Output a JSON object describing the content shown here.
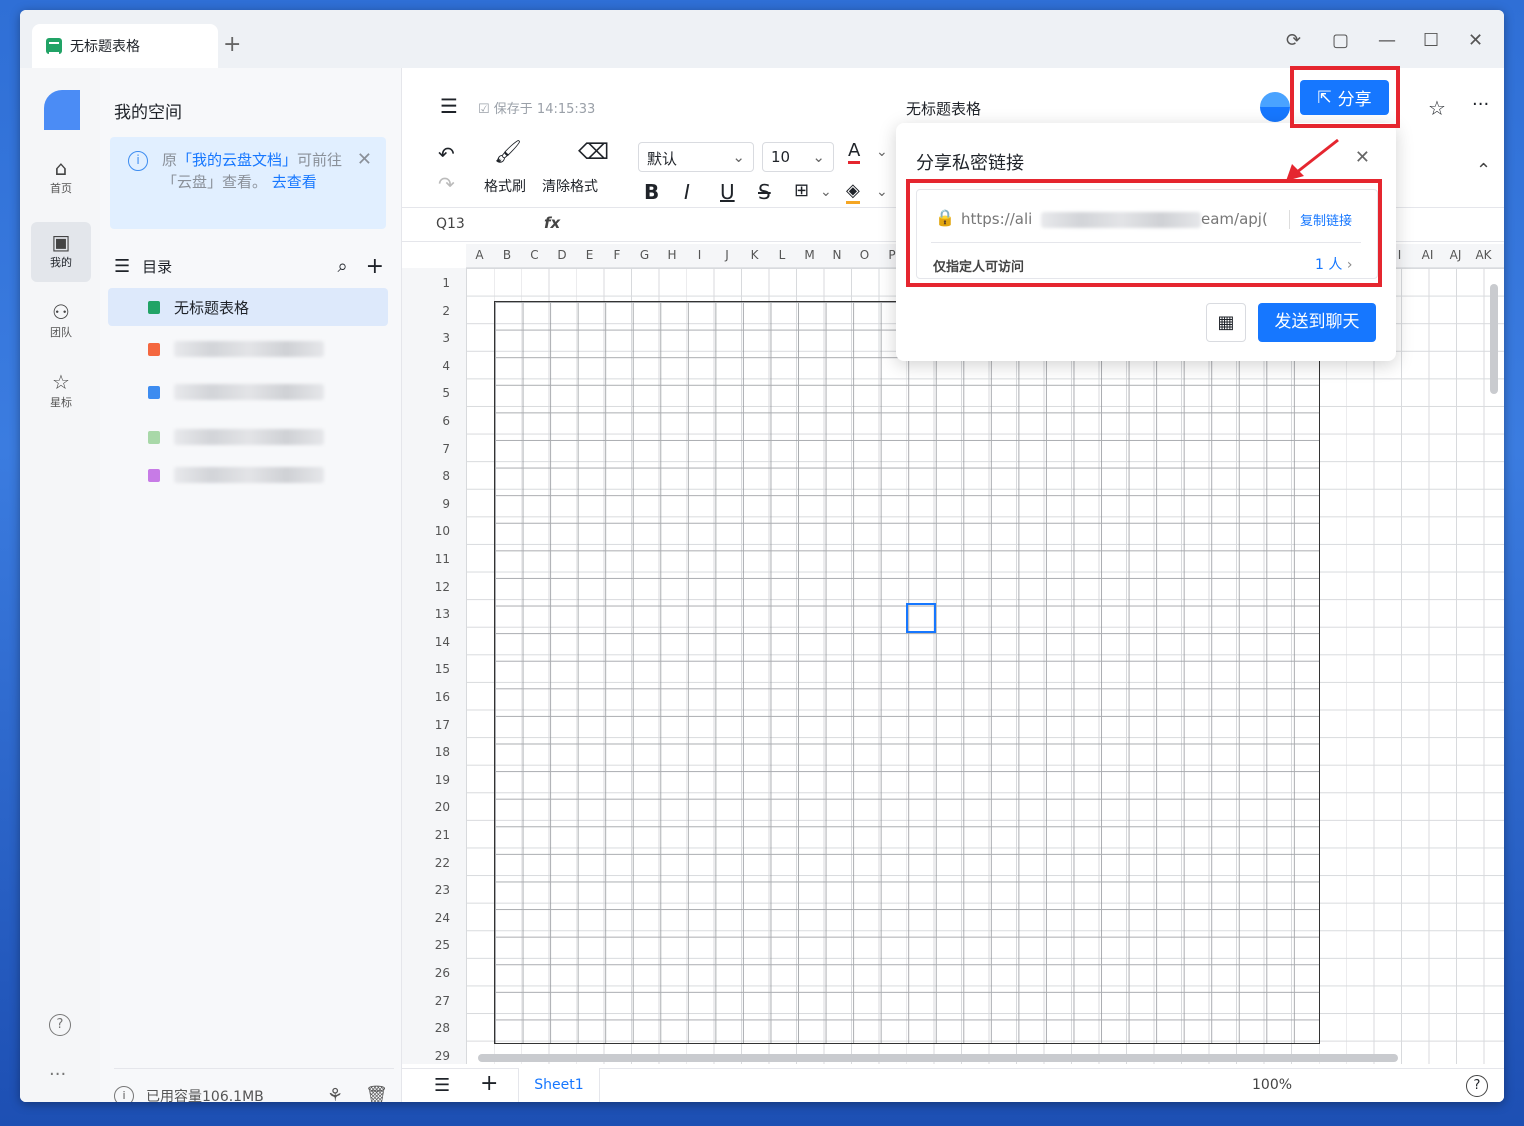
{
  "window": {
    "tab_title": "无标题表格",
    "controls": [
      "⟳",
      "▢",
      "—",
      "☐",
      "✕"
    ]
  },
  "rail": {
    "items": [
      {
        "icon": "home-icon",
        "label": "首页"
      },
      {
        "icon": "folder-user-icon",
        "label": "我的"
      },
      {
        "icon": "team-icon",
        "label": "团队"
      },
      {
        "icon": "star-icon",
        "label": "星标"
      }
    ]
  },
  "sidebar": {
    "title": "我的空间",
    "notice": {
      "prefix": "原",
      "highlight": "「我的云盘文档」",
      "middle": "可前往「云盘」查看。",
      "link": "去查看"
    },
    "toc_label": "目录",
    "files": [
      {
        "name": "无标题表格",
        "type": "sheet",
        "selected": true
      },
      {
        "name": "",
        "type": "ppt"
      },
      {
        "name": "",
        "type": "doc"
      },
      {
        "name": "",
        "type": "image"
      },
      {
        "name": "",
        "type": "mindmap"
      }
    ],
    "storage": "已用容量106.1MB"
  },
  "header": {
    "save_status": "保存于 14:15:33",
    "doc_title": "无标题表格",
    "share_label": "分享"
  },
  "toolbar": {
    "format_painter": "格式刷",
    "clear_format": "清除格式",
    "font": "默认",
    "font_size": "10",
    "bold": "B",
    "italic": "I",
    "underline": "U",
    "strike": "S"
  },
  "formula": {
    "cell_ref": "Q13",
    "fx": "fx"
  },
  "grid": {
    "columns": [
      "A",
      "B",
      "C",
      "D",
      "E",
      "F",
      "G",
      "H",
      "I",
      "J",
      "K",
      "L",
      "M",
      "N",
      "O",
      "P"
    ],
    "right_columns": [
      "I",
      "AI",
      "AJ",
      "AK",
      "Al"
    ],
    "rows": [
      "1",
      "2",
      "3",
      "4",
      "5",
      "6",
      "7",
      "8",
      "9",
      "10",
      "11",
      "12",
      "13",
      "14",
      "15",
      "16",
      "17",
      "18",
      "19",
      "20",
      "21",
      "22",
      "23",
      "24",
      "25",
      "26",
      "27",
      "28",
      "29"
    ]
  },
  "footer": {
    "sheet_tab": "Sheet1",
    "zoom": "100%"
  },
  "share_popup": {
    "title": "分享私密链接",
    "url_start": "https://ali",
    "url_end": "eam/apj(",
    "copy_link": "复制链接",
    "access_label": "仅指定人可访问",
    "access_count": "1 人",
    "send_button": "发送到聊天"
  },
  "colors": {
    "accent": "#1677ff",
    "highlight_red": "#e5262f"
  }
}
